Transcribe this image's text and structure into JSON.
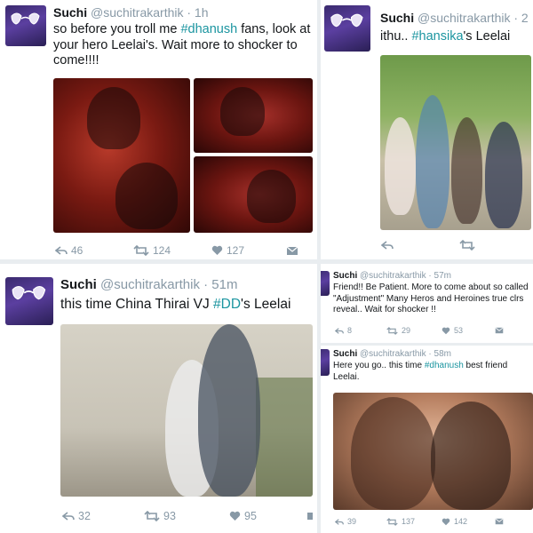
{
  "tweet1": {
    "name": "Suchi",
    "handle": "@suchitrakarthik",
    "time": "· 1h",
    "text_before": "so before you troll me ",
    "hashtag": "#dhanush",
    "text_after": " fans, look at your hero Leelai's. Wait more to shocker to come!!!!",
    "reply_count": "46",
    "retweet_count": "124",
    "like_count": "127"
  },
  "tweet2": {
    "name": "Suchi",
    "handle": "@suchitrakarthik",
    "time": "· 2",
    "text_before": "ithu.. ",
    "hashtag": "#hansika",
    "text_after": "'s Leelai"
  },
  "tweet3": {
    "name": "Suchi",
    "handle": "@suchitrakarthik",
    "time": "· 51m",
    "text_before": "this time China Thirai VJ ",
    "hashtag": "#DD",
    "text_after": "'s Leelai",
    "reply_count": "32",
    "retweet_count": "93",
    "like_count": "95"
  },
  "tweet4": {
    "name": "Suchi",
    "handle": "@suchitrakarthik",
    "time": "· 57m",
    "text": "Friend!! Be Patient. More to come about so called \"Adjustment\" Many Heros and Heroines true clrs reveal.. Wait for shocker !!",
    "reply_count": "8",
    "retweet_count": "29",
    "like_count": "53"
  },
  "tweet5": {
    "name": "Suchi",
    "handle": "@suchitrakarthik",
    "time": "· 58m",
    "text_before": "Here you go.. this time ",
    "hashtag": "#dhanush",
    "text_after": " best friend Leelai.",
    "reply_count": "39",
    "retweet_count": "137",
    "like_count": "142"
  },
  "colors": {
    "hashtag": "#1b95a0",
    "muted": "#8899a6",
    "avatar": "#4b3590"
  }
}
